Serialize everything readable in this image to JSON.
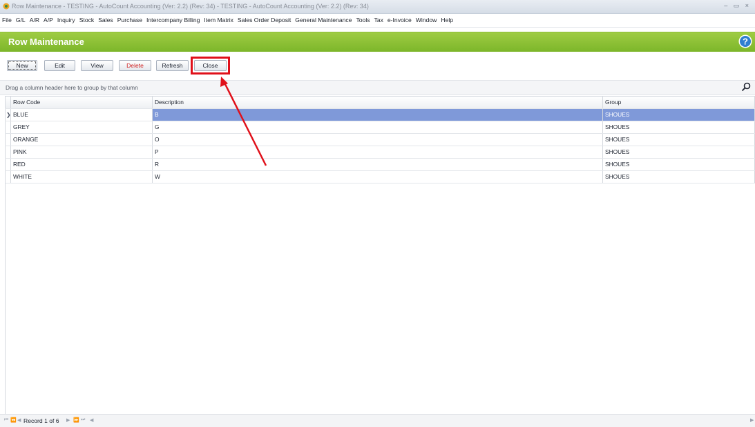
{
  "window": {
    "title": "Row Maintenance - TESTING - AutoCount Accounting (Ver: 2.2) (Rev: 34) - TESTING - AutoCount Accounting (Ver: 2.2) (Rev: 34)",
    "controls": "– ▭ ×"
  },
  "menu": [
    "File",
    "G/L",
    "A/R",
    "A/P",
    "Inquiry",
    "Stock",
    "Sales",
    "Purchase",
    "Intercompany Billing",
    "Item Matrix",
    "Sales Order Deposit",
    "General Maintenance",
    "Tools",
    "Tax",
    "e-Invoice",
    "Window",
    "Help"
  ],
  "header": {
    "title": "Row Maintenance",
    "help_icon": "help-icon"
  },
  "toolbar": {
    "new": "New",
    "edit": "Edit",
    "view": "View",
    "delete": "Delete",
    "refresh": "Refresh",
    "close": "Close"
  },
  "grid": {
    "group_hint": "Drag a column header here to group by that column",
    "columns": [
      "Row Code",
      "Description",
      "Group"
    ],
    "rows": [
      {
        "code": "BLUE",
        "description": "B",
        "group": "SHOUES"
      },
      {
        "code": "GREY",
        "description": "G",
        "group": "SHOUES"
      },
      {
        "code": "ORANGE",
        "description": "O",
        "group": "SHOUES"
      },
      {
        "code": "PINK",
        "description": "P",
        "group": "SHOUES"
      },
      {
        "code": "RED",
        "description": "R",
        "group": "SHOUES"
      },
      {
        "code": "WHITE",
        "description": "W",
        "group": "SHOUES"
      }
    ]
  },
  "navigator": {
    "record_text": "Record 1 of 6"
  },
  "colors": {
    "header_green": "#8bc034",
    "selection_blue": "#7f99d9",
    "annotation_red": "#e0101a"
  }
}
